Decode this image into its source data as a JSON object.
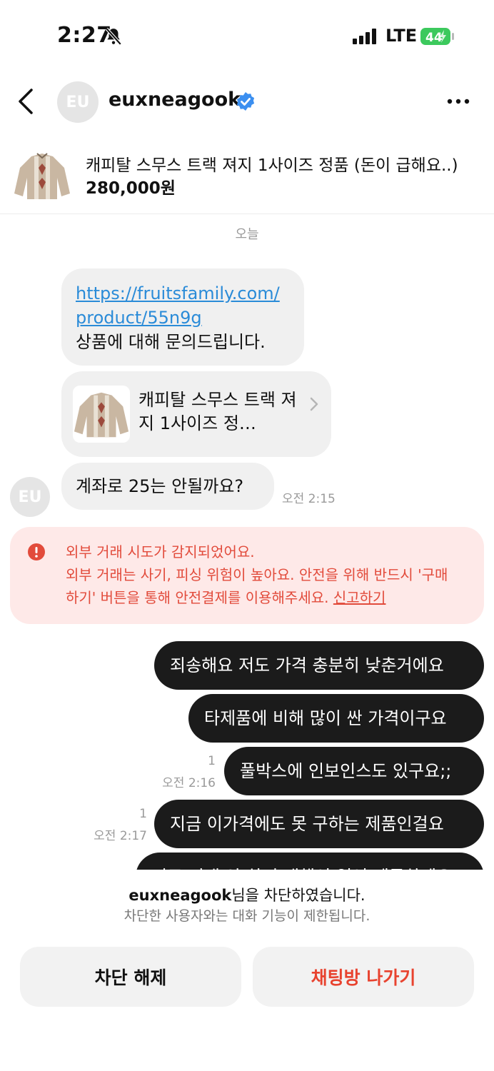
{
  "status_bar": {
    "time": "2:27",
    "network": "LTE",
    "battery": "44"
  },
  "header": {
    "avatar_initials": "EU",
    "username": "euxneagook"
  },
  "product": {
    "title": "캐피탈 스무스 트랙 져지 1사이즈 정품 (돈이 급해요..)",
    "price": "280,000원"
  },
  "chat": {
    "date_label": "오늘",
    "incoming": {
      "link_line1": "https://fruitsfamily.com/",
      "link_line2": "product/55n9g",
      "inquiry_text": "상품에 대해 문의드립니다.",
      "card_text": "캐피탈 스무스 트랙 져지 1사이즈 정…",
      "message": "계좌로 25는 안될까요?",
      "time": "오전 2:15",
      "avatar_initials": "EU"
    },
    "warning": {
      "line1": "외부 거래 시도가 감지되었어요.",
      "line2": "외부 거래는 사기, 피싱 위험이 높아요. 안전을 위해 반드시 '구매",
      "line3": "하기' 버튼을 통해 안전결제를 이용해주세요.",
      "report_link": "신고하기"
    },
    "outgoing": [
      {
        "text": "죄송해요 저도 가격 충분히 낮춘거에요"
      },
      {
        "text": "타제품에 비해 많이 싼 가격이구요"
      },
      {
        "text": "풀박스에 인보인스도 있구요;;",
        "read_count": "1",
        "time": "오전 2:16"
      },
      {
        "text": "지금 이가격에도 못 구하는 제품인걸요",
        "read_count": "1",
        "time": "오전 2:17"
      },
      {
        "text": "저도 거래 안 하면 대책이 없어 제공하세요"
      }
    ]
  },
  "blocked": {
    "username": "euxneagook",
    "line1_suffix": "님을 차단하였습니다.",
    "line2": "차단한 사용자와는 대화 기능이 제한됩니다.",
    "unblock_label": "차단 해제",
    "leave_label": "채팅방 나가기"
  },
  "colors": {
    "link": "#2a8bd8",
    "warning": "#e24b3b",
    "warning_bg": "#fee9e8",
    "verified": "#3b8ff0",
    "leave": "#e8432f",
    "battery": "#3cc95d"
  }
}
